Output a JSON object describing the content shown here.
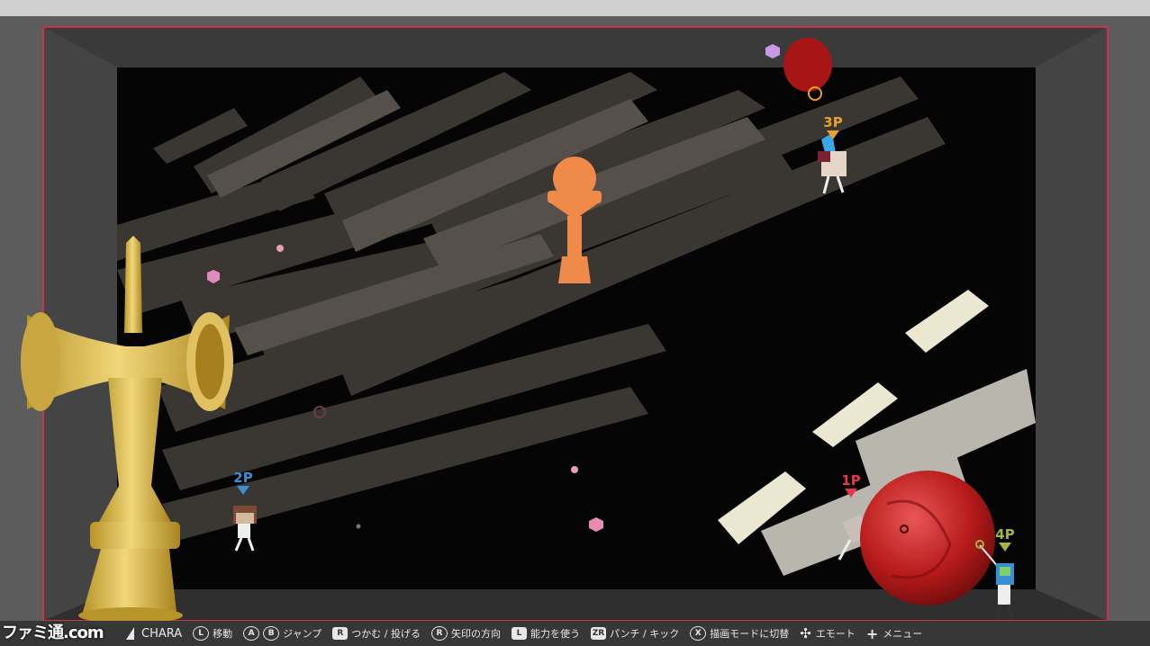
{
  "players": {
    "p1": {
      "label": "1P",
      "color": "#e8364b"
    },
    "p2": {
      "label": "2P",
      "color": "#3a8fd1"
    },
    "p3": {
      "label": "3P",
      "color": "#e8a12a"
    },
    "p4": {
      "label": "4P",
      "color": "#a3b53c"
    }
  },
  "controls": {
    "chara": "CHARA",
    "move": {
      "button": "L",
      "label": "移動"
    },
    "jump": {
      "button_a": "A",
      "button_b": "B",
      "label": "ジャンプ"
    },
    "grab": {
      "button": "R",
      "label": "つかむ / 投げる"
    },
    "aim": {
      "button": "R",
      "label": "矢印の方向"
    },
    "ability": {
      "button": "L",
      "label": "能力を使う"
    },
    "attack": {
      "button": "ZR",
      "label": "パンチ / キック"
    },
    "draw_mode": {
      "button": "X",
      "label": "描画モードに切替"
    },
    "emote": {
      "label": "エモート"
    },
    "menu": {
      "label": "メニュー"
    }
  },
  "watermark": "ファミ通.com",
  "icons": [
    "chara-icon",
    "dpad-icon",
    "plus-icon"
  ]
}
